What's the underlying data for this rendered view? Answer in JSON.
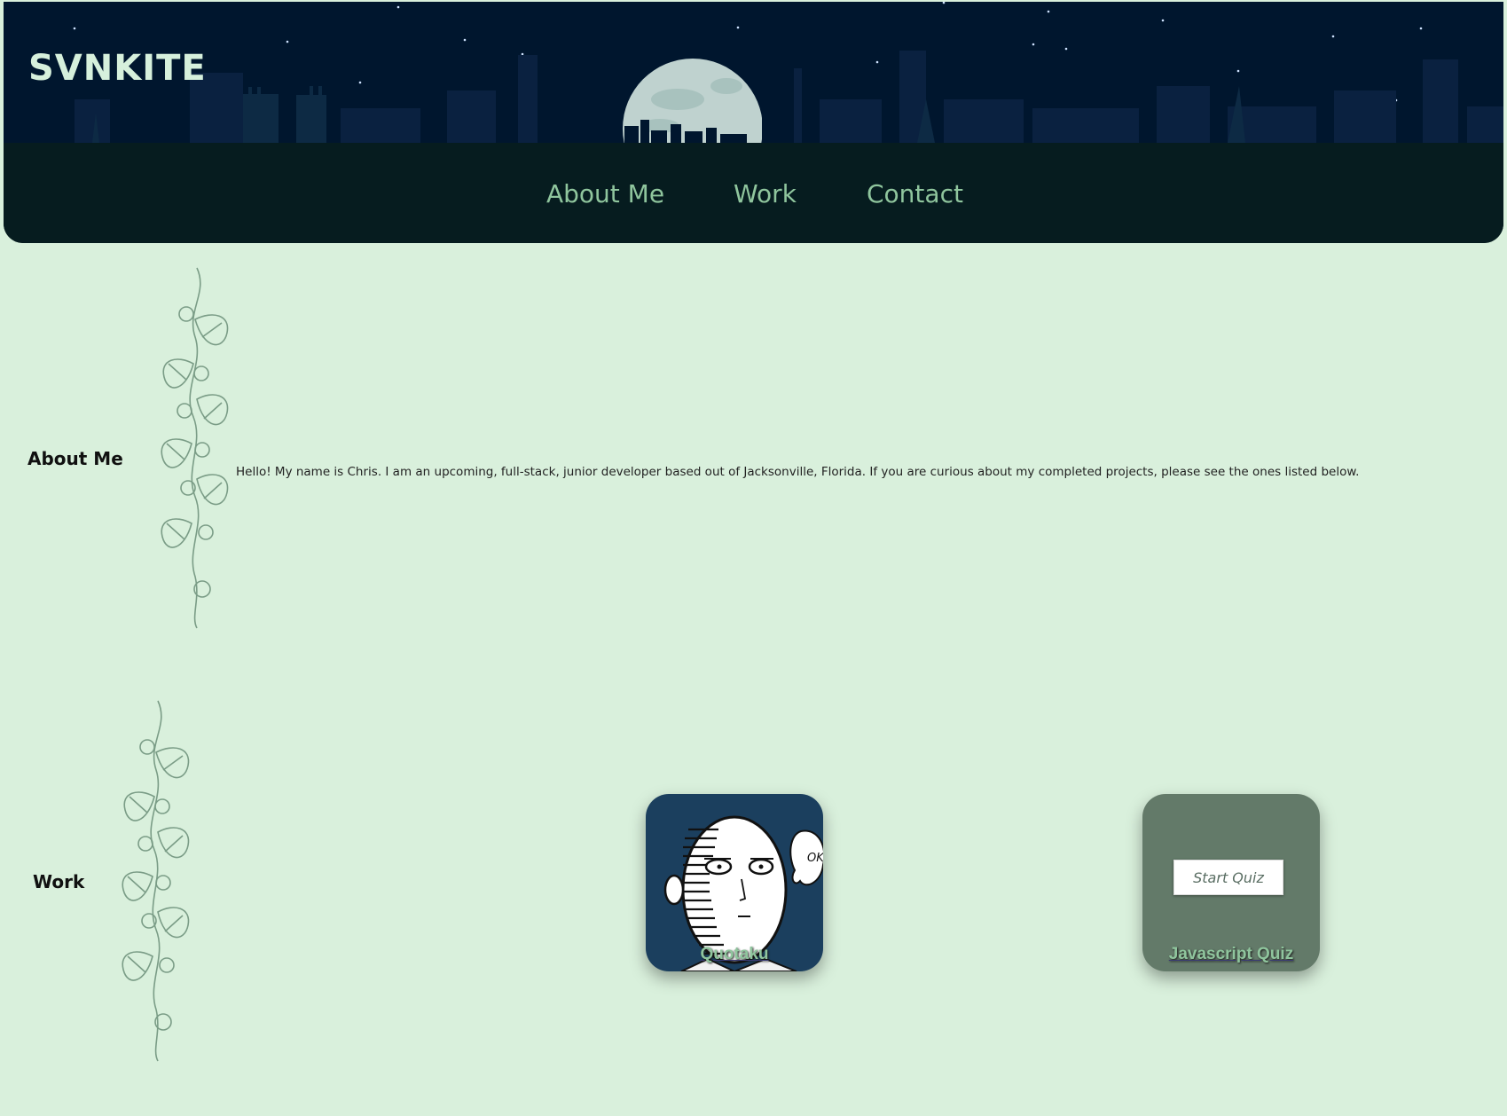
{
  "brand": {
    "name": "SVNKITE"
  },
  "nav": {
    "items": [
      {
        "label": "About Me"
      },
      {
        "label": "Work"
      },
      {
        "label": "Contact"
      }
    ]
  },
  "about": {
    "title": "About Me",
    "text": "Hello! My name is Chris. I am an upcoming, full-stack, junior developer based out of Jacksonville, Florida. If you are curious about my completed projects, please see the ones listed below."
  },
  "work": {
    "title": "Work",
    "projects": [
      {
        "title": "Quotaku",
        "bubble_text": "OK"
      },
      {
        "title": "Javascript Quiz",
        "button_label": "Start Quiz"
      }
    ]
  },
  "colors": {
    "page_bg": "#d9f0dc",
    "header_sky": "#00162e",
    "header_bar": "#061c1f",
    "nav_text": "#8fc59d",
    "quiz_card": "#637a69",
    "quotaku_card": "#1b3f5e"
  }
}
